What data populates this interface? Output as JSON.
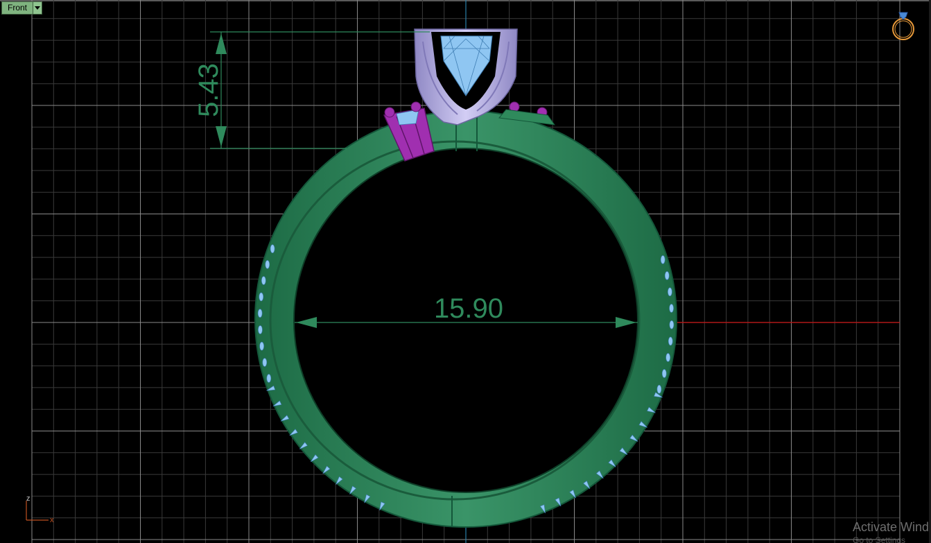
{
  "viewport": {
    "title": "Front",
    "background": "#000000",
    "grid_color": "#4a4a4a",
    "grid_major_color": "#9a9a9a"
  },
  "dimensions": {
    "height_value": "5.43",
    "width_value": "15.90",
    "color": "#2f8a5c"
  },
  "axes_widget": {
    "z_label": "z",
    "x_label": "x"
  },
  "colors": {
    "band": "#2f8a5c",
    "band_dark": "#1f6b44",
    "prongs": "#bdb6e8",
    "gem": "#8fc6f2",
    "accent_stones": "#a02fb0",
    "x_axis": "#b01818",
    "z_axis": "#2a7fa8"
  },
  "nav_icon": "ring-icon",
  "watermark": {
    "line1": "Activate Wind",
    "line2": "Go to Settings"
  }
}
